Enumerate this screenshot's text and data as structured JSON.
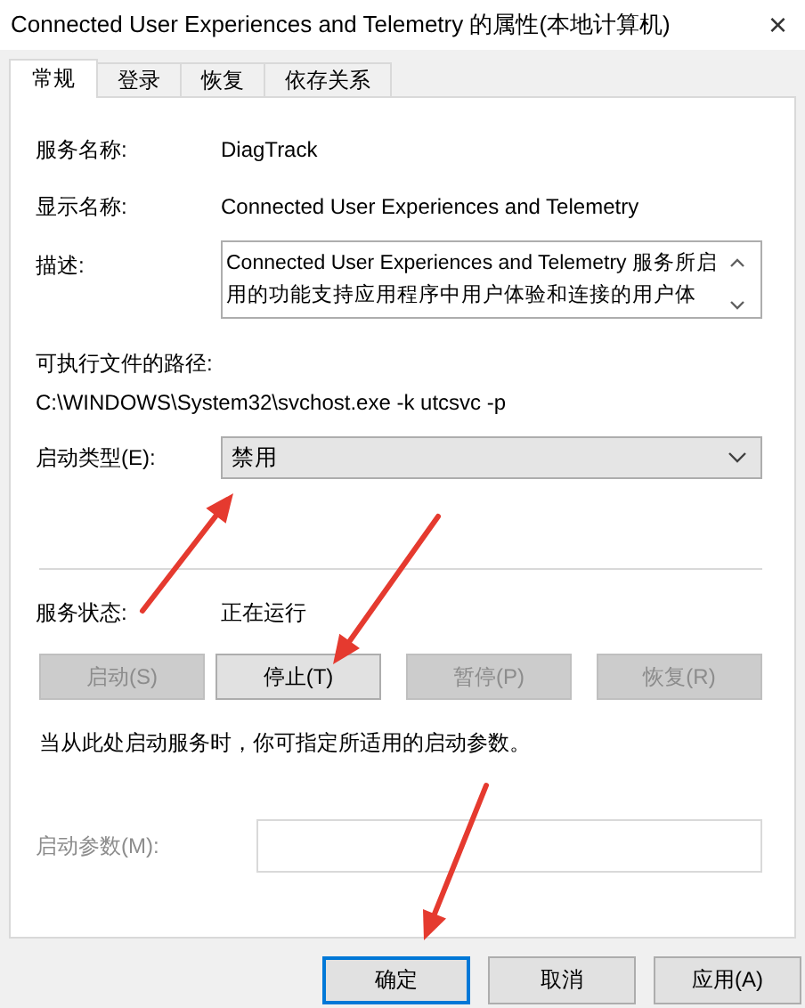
{
  "window": {
    "title": "Connected User Experiences and Telemetry 的属性(本地计算机)",
    "close": "×"
  },
  "tabs": [
    {
      "label": "常规",
      "selected": true
    },
    {
      "label": "登录",
      "selected": false
    },
    {
      "label": "恢复",
      "selected": false
    },
    {
      "label": "依存关系",
      "selected": false
    }
  ],
  "fields": [
    {
      "label": "服务名称:",
      "value": "DiagTrack"
    },
    {
      "label": "显示名称:",
      "value": "Connected User Experiences and Telemetry"
    }
  ],
  "description": {
    "label": "描述:",
    "text": "Connected User Experiences and Telemetry 服务所启用的功能支持应用程序中用户体验和连接的用户体"
  },
  "path": {
    "label": "可执行文件的路径:",
    "value": "C:\\WINDOWS\\System32\\svchost.exe -k utcsvc -p"
  },
  "startup_type": {
    "label": "启动类型(E):",
    "value": "禁用"
  },
  "status": {
    "label": "服务状态:",
    "value": "正在运行"
  },
  "service_buttons": [
    {
      "label": "启动(S)",
      "disabled": true
    },
    {
      "label": "停止(T)",
      "disabled": false
    },
    {
      "label": "暂停(P)",
      "disabled": true
    },
    {
      "label": "恢复(R)",
      "disabled": true
    }
  ],
  "hint": "当从此处启动服务时，你可指定所适用的启动参数。",
  "start_params": {
    "label": "启动参数(M):",
    "disabled": true
  },
  "dialog_buttons": [
    {
      "label": "确定",
      "default": true
    },
    {
      "label": "取消",
      "default": false
    },
    {
      "label": "应用(A)",
      "default": false
    }
  ]
}
